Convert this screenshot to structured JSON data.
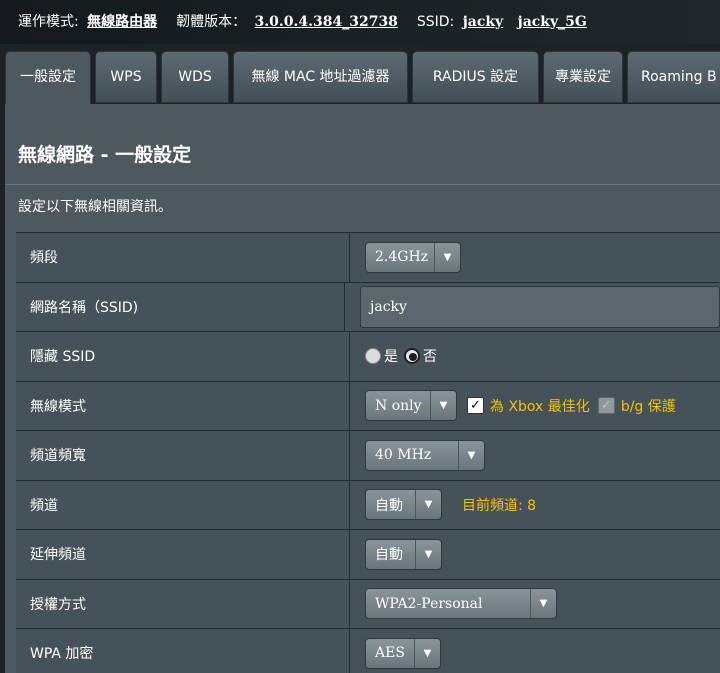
{
  "topbar": {
    "mode_label": "運作模式:",
    "mode_value": "無線路由器",
    "firmware_label": "韌體版本：",
    "firmware_value": "3.0.0.4.384_32738",
    "ssid_label": "SSID:",
    "ssid_1": "jacky",
    "ssid_2": "jacky_5G"
  },
  "tabs": [
    {
      "label": "一般設定"
    },
    {
      "label": "WPS"
    },
    {
      "label": "WDS"
    },
    {
      "label": "無線 MAC 地址過濾器"
    },
    {
      "label": "RADIUS 設定"
    },
    {
      "label": "專業設定"
    },
    {
      "label": "Roaming B"
    }
  ],
  "page": {
    "title": "無線網路 - 一般設定",
    "description": "設定以下無線相關資訊。"
  },
  "settings": {
    "band": {
      "label": "頻段",
      "value": "2.4GHz"
    },
    "ssid": {
      "label": "網路名稱（SSID)",
      "value": "jacky"
    },
    "hide_ssid": {
      "label": "隱藏 SSID",
      "option_yes": "是",
      "option_no": "否"
    },
    "wireless_mode": {
      "label": "無線模式",
      "value": "N only",
      "xbox_label": "為 Xbox 最佳化",
      "bg_label": "b/g 保護"
    },
    "channel_bandwidth": {
      "label": "頻道頻寬",
      "value": "40 MHz"
    },
    "channel": {
      "label": "頻道",
      "value": "自動",
      "current": "目前頻道: 8"
    },
    "ext_channel": {
      "label": "延伸頻道",
      "value": "自動"
    },
    "auth_method": {
      "label": "授權方式",
      "value": "WPA2-Personal"
    },
    "wpa_encryption": {
      "label": "WPA 加密",
      "value": "AES"
    }
  },
  "colors": {
    "accent_yellow": "#f3c300",
    "panel": "#4d585f",
    "background": "#1b2327"
  }
}
